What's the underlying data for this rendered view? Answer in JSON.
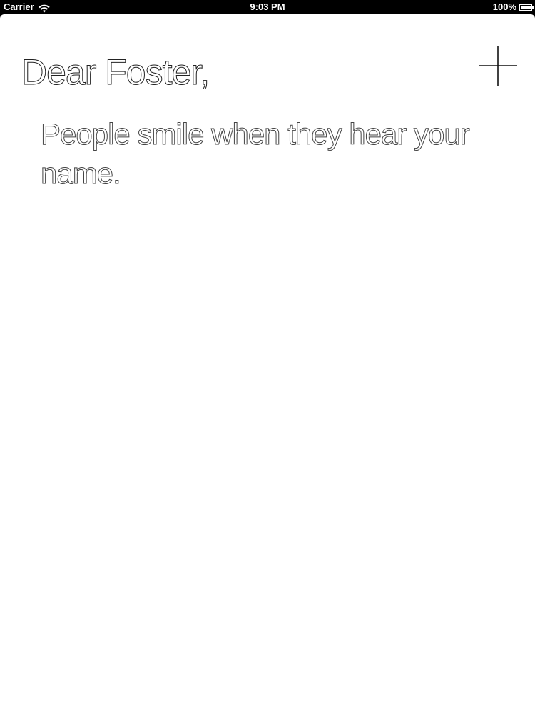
{
  "status_bar": {
    "carrier": "Carrier",
    "wifi_icon": "wifi-icon",
    "time": "9:03 PM",
    "battery_percent": "100%",
    "battery_icon": "battery-icon",
    "battery_level": 1.0
  },
  "note": {
    "greeting": "Dear Foster,",
    "message": "People smile when they hear your name.",
    "add_icon": "plus-icon"
  },
  "colors": {
    "background": "#ffffff",
    "status_bar": "#000000",
    "text": "#333333"
  }
}
